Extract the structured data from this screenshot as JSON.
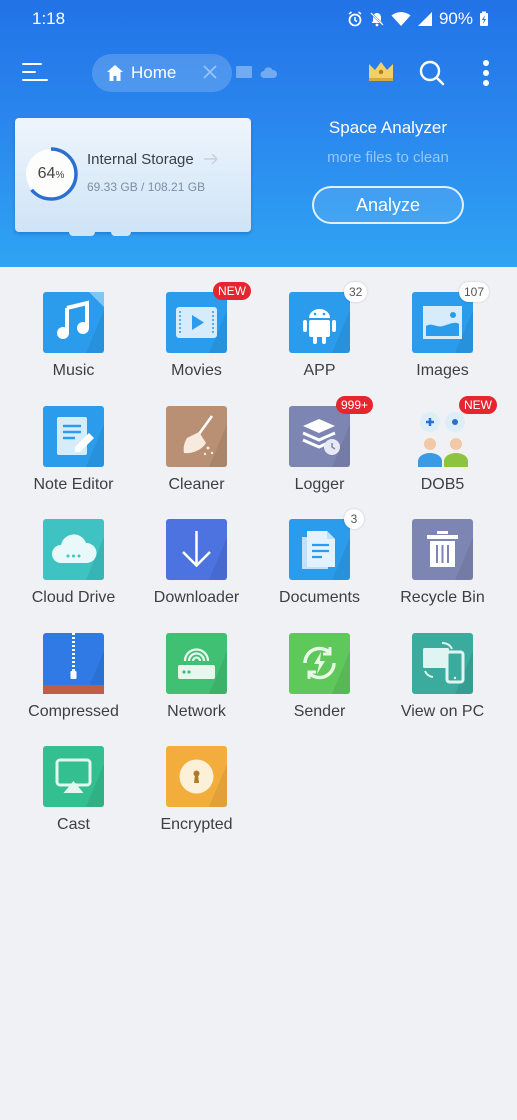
{
  "status_bar": {
    "time": "1:18",
    "battery": "90%"
  },
  "toolbar": {
    "tab_label": "Home",
    "icons": [
      "menu-icon",
      "home-icon",
      "close-icon",
      "grid-icon",
      "cloud-icon",
      "crown-icon",
      "search-icon",
      "more-vert-icon"
    ]
  },
  "storage": {
    "title": "Internal Storage",
    "used": "69.33 GB",
    "total": "108.21 GB",
    "usage_text": "69.33 GB / 108.21 GB",
    "percent": 64,
    "percent_number": "64",
    "percent_sign": "%"
  },
  "analyzer": {
    "title": "Space Analyzer",
    "subtitle": "more files to clean",
    "button_label": "Analyze"
  },
  "colors": {
    "header_top": "#2273e6",
    "header_bottom": "#2fa4f3",
    "badge_red": "#e6262e",
    "background": "#f0f1f4"
  },
  "grid": [
    {
      "label": "Music",
      "icon": "music-icon",
      "color": "#2b9cec"
    },
    {
      "label": "Movies",
      "icon": "movie-icon",
      "color": "#2b9cec",
      "badge": "NEW",
      "badge_style": "red"
    },
    {
      "label": "APP",
      "icon": "android-icon",
      "color": "#2b9cec",
      "badge": "32",
      "badge_style": "white"
    },
    {
      "label": "Images",
      "icon": "image-icon",
      "color": "#2b9cec",
      "badge": "107",
      "badge_style": "white"
    },
    {
      "label": "Note Editor",
      "icon": "note-edit-icon",
      "color": "#2b9cec"
    },
    {
      "label": "Cleaner",
      "icon": "broom-icon",
      "color": "#b99073"
    },
    {
      "label": "Logger",
      "icon": "logger-icon",
      "color": "#7d86b3",
      "badge": "999+",
      "badge_style": "red"
    },
    {
      "label": "DOB5",
      "icon": "game-people-icon",
      "color": "#ffffff",
      "badge": "NEW",
      "badge_style": "red"
    },
    {
      "label": "Cloud Drive",
      "icon": "cloud-icon",
      "color": "#3ec2c2"
    },
    {
      "label": "Downloader",
      "icon": "download-icon",
      "color": "#4c73e0"
    },
    {
      "label": "Documents",
      "icon": "document-icon",
      "color": "#2b9cec",
      "badge": "3",
      "badge_style": "white"
    },
    {
      "label": "Recycle Bin",
      "icon": "trash-icon",
      "color": "#7d86b3"
    },
    {
      "label": "Compressed",
      "icon": "zip-icon",
      "color": "#2f7ae5"
    },
    {
      "label": "Network",
      "icon": "router-icon",
      "color": "#3fc072"
    },
    {
      "label": "Sender",
      "icon": "sender-icon",
      "color": "#5ec85a"
    },
    {
      "label": "View on PC",
      "icon": "view-on-pc-icon",
      "color": "#3bab9d"
    },
    {
      "label": "Cast",
      "icon": "cast-icon",
      "color": "#33bf8f"
    },
    {
      "label": "Encrypted",
      "icon": "lock-icon",
      "color": "#f3ad3d"
    }
  ]
}
